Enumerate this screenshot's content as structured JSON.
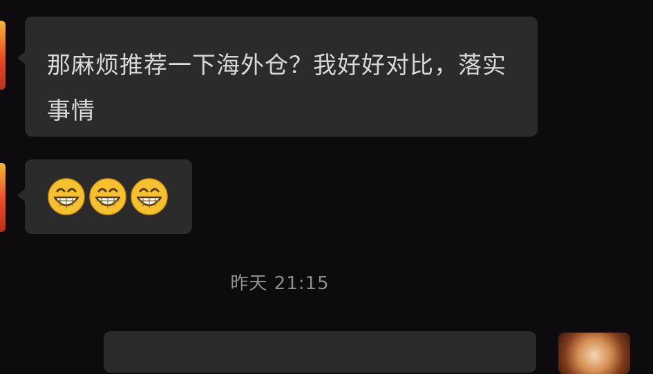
{
  "chat": {
    "messages": [
      {
        "direction": "incoming",
        "text": "那麻烦推荐一下海外仓？我好好对比，落实事情"
      },
      {
        "direction": "incoming",
        "emojis": [
          "grinning-face-icon",
          "grinning-face-icon",
          "grinning-face-icon"
        ]
      }
    ],
    "timestamp": "昨天 21:15"
  },
  "colors": {
    "background": "#0d0b0d",
    "bubble": "#2b2b2b",
    "text": "#d8d8d8",
    "timestamp": "#8d8d8d",
    "emoji_face": "#f6c12f"
  }
}
